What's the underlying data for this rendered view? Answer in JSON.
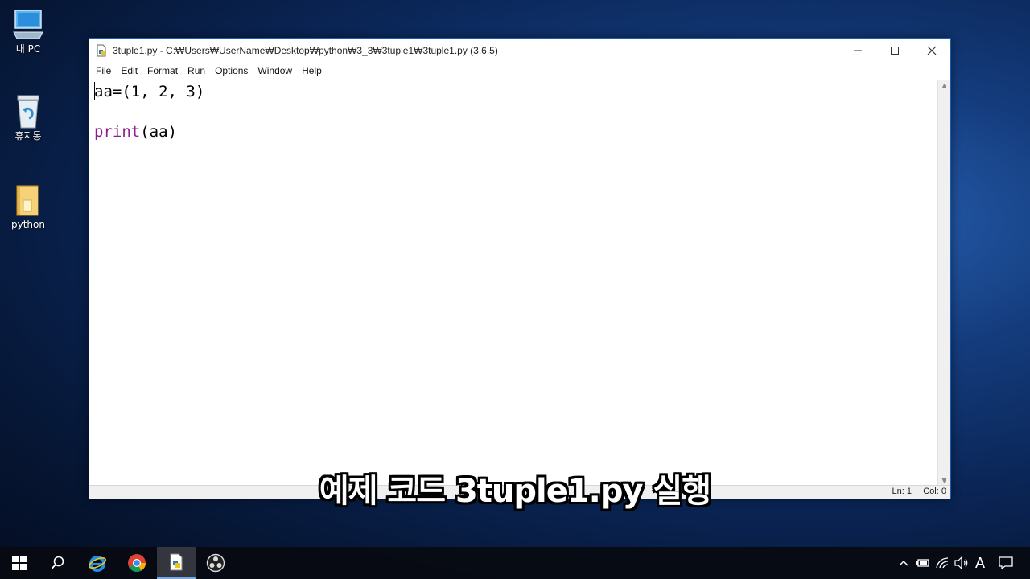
{
  "desktop": {
    "icons": [
      {
        "label": "내 PC",
        "icon": "this-pc-icon"
      },
      {
        "label": "휴지통",
        "icon": "recycle-bin-icon"
      },
      {
        "label": "python",
        "icon": "folder-icon"
      }
    ]
  },
  "window": {
    "title": "3tuple1.py - C:₩Users₩UserName₩Desktop₩python₩3_3₩3tuple1₩3tuple1.py (3.6.5)",
    "menu": [
      "File",
      "Edit",
      "Format",
      "Run",
      "Options",
      "Window",
      "Help"
    ],
    "code": {
      "line1": "aa=(1, 2, 3)",
      "line3_keyword": "print",
      "line3_rest": "(aa)"
    },
    "status": {
      "ln": "Ln: 1",
      "col": "Col: 0"
    }
  },
  "subtitle": "예제 코드 3tuple1.py 실행",
  "taskbar": {
    "apps": [
      "start-icon",
      "search-icon",
      "internet-explorer-icon",
      "chrome-icon",
      "python-idle-icon",
      "obs-icon"
    ],
    "tray": {
      "ime": "A"
    }
  },
  "colors": {
    "keyword": "#8b1f8b",
    "window_border": "#1b5db5",
    "taskbar": "#080a10"
  }
}
